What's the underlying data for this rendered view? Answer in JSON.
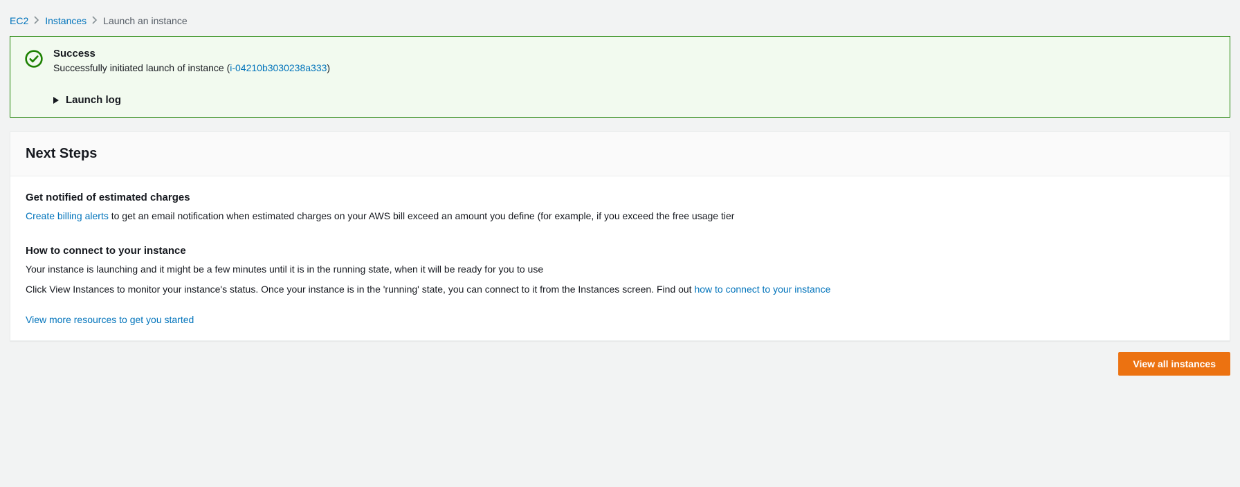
{
  "breadcrumb": {
    "ec2": "EC2",
    "instances": "Instances",
    "current": "Launch an instance"
  },
  "alert": {
    "title": "Success",
    "msg_prefix": "Successfully initiated launch of instance (",
    "instance_id": "i-04210b3030238a333",
    "msg_suffix": ")",
    "launch_log_label": "Launch log"
  },
  "next_steps": {
    "heading": "Next Steps",
    "billing": {
      "title": "Get notified of estimated charges",
      "link": "Create billing alerts",
      "rest": " to get an email notification when estimated charges on your AWS bill exceed an amount you define (for example, if you exceed the free usage tier"
    },
    "connect": {
      "title": "How to connect to your instance",
      "p1": "Your instance is launching and it might be a few minutes until it is in the running state, when it will be ready for you to use",
      "p2_prefix": "Click View Instances to monitor your instance's status. Once your instance is in the 'running' state, you can connect to it from the Instances screen. Find out ",
      "p2_link": "how to connect to your instance"
    },
    "more_resources_link": "View more resources to get you started"
  },
  "footer": {
    "view_all_btn": "View all instances"
  }
}
